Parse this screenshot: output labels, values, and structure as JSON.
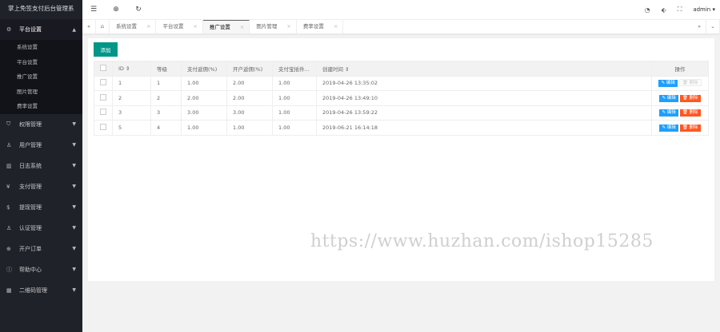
{
  "app_title": "掌上免签支付后台管理系",
  "sidebar": {
    "items": [
      {
        "label": "平台设置",
        "icon": "gear-icon",
        "open": true,
        "children": [
          "系统设置",
          "平台设置",
          "推广设置",
          "图片管理",
          "费率设置"
        ]
      },
      {
        "label": "权限管理",
        "icon": "shield-icon"
      },
      {
        "label": "用户管理",
        "icon": "user-icon"
      },
      {
        "label": "日志系统",
        "icon": "book-icon"
      },
      {
        "label": "支付管理",
        "icon": "yen-icon"
      },
      {
        "label": "提现管理",
        "icon": "dollar-icon"
      },
      {
        "label": "认证管理",
        "icon": "user-check-icon"
      },
      {
        "label": "开户订单",
        "icon": "globe-icon"
      },
      {
        "label": "帮助中心",
        "icon": "info-icon"
      },
      {
        "label": "二维码管理",
        "icon": "qrcode-icon"
      }
    ]
  },
  "header": {
    "user": "admin"
  },
  "tabs": [
    {
      "label": "系统设置"
    },
    {
      "label": "平台设置"
    },
    {
      "label": "推广设置",
      "active": true
    },
    {
      "label": "图片管理"
    },
    {
      "label": "费率设置"
    }
  ],
  "toolbar": {
    "add_label": "添加"
  },
  "table": {
    "headers": [
      "ID",
      "等级",
      "支付返佣(%)",
      "开户返佣(%)",
      "支付宝插件...",
      "创建时间",
      "操作"
    ],
    "rows": [
      [
        "1",
        "1",
        "1.00",
        "2.00",
        "1.00",
        "2019-04-26 13:35:02"
      ],
      [
        "2",
        "2",
        "2.00",
        "2.00",
        "1.00",
        "2019-04-26 13:49:10"
      ],
      [
        "3",
        "3",
        "3.00",
        "3.00",
        "1.00",
        "2019-04-26 13:59:22"
      ],
      [
        "5",
        "4",
        "1.00",
        "1.00",
        "1.00",
        "2019-06-21 16:14:18"
      ]
    ],
    "edit_label": "编辑",
    "delete_label": "删除"
  },
  "watermark": "https://www.huzhan.com/ishop15285"
}
